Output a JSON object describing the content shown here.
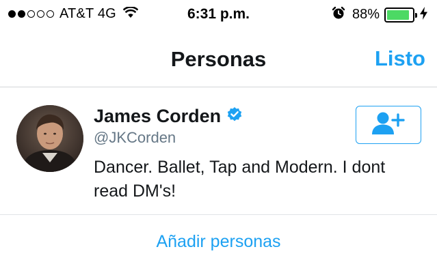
{
  "status_bar": {
    "carrier": "AT&T 4G",
    "time": "6:31 p.m.",
    "battery_percent": "88%",
    "signal_bars_filled": 2,
    "signal_bars_total": 5,
    "battery_level": 0.88,
    "icons": [
      "wifi-icon",
      "alarm-icon",
      "battery-icon",
      "charging-bolt-icon"
    ]
  },
  "nav": {
    "title": "Personas",
    "done_label": "Listo"
  },
  "person": {
    "name": "James Corden",
    "handle": "@JKCorden",
    "bio": "Dancer. Ballet, Tap and Modern. I dont read DM's!",
    "verified": true,
    "follow_icon": "add-user-icon"
  },
  "footer": {
    "add_people_label": "Añadir personas"
  },
  "colors": {
    "accent": "#1da1f2",
    "battery": "#4cd964",
    "secondary_text": "#657786"
  }
}
